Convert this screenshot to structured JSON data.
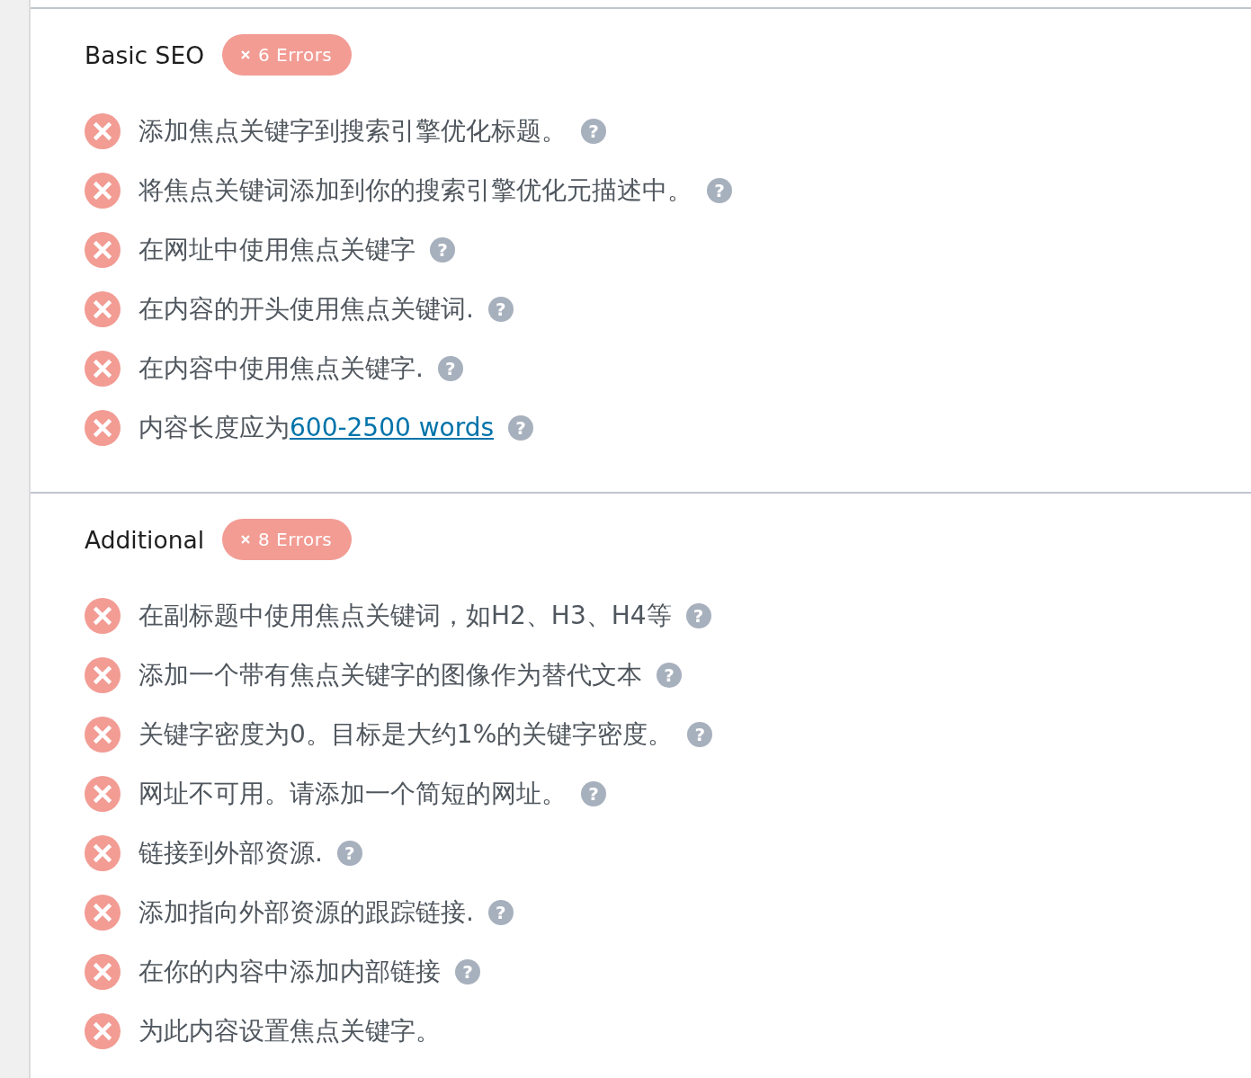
{
  "sections": [
    {
      "title": "Basic SEO",
      "badge": {
        "failed": true,
        "label": "6 Errors"
      },
      "checks": [
        {
          "failed": true,
          "text": "添加焦点关键字到搜索引擎优化标题。",
          "help": "?"
        },
        {
          "failed": true,
          "text": "将焦点关键词添加到你的搜索引擎优化元描述中。",
          "help": "?"
        },
        {
          "failed": true,
          "text": "在网址中使用焦点关键字",
          "help": "?"
        },
        {
          "failed": true,
          "text": "在内容的开头使用焦点关键词.",
          "help": "?"
        },
        {
          "failed": true,
          "text": "在内容中使用焦点关键字.",
          "help": "?"
        },
        {
          "failed": true,
          "text": "内容长度应为",
          "link": "600-2500 words",
          "help": "?"
        }
      ]
    },
    {
      "title": "Additional",
      "badge": {
        "failed": true,
        "label": "8 Errors"
      },
      "checks": [
        {
          "failed": true,
          "text": "在副标题中使用焦点关键词，如H2、H3、H4等",
          "help": "?"
        },
        {
          "failed": true,
          "text": "添加一个带有焦点关键字的图像作为替代文本",
          "help": "?"
        },
        {
          "failed": true,
          "text": "关键字密度为0。目标是大约1%的关键字密度。",
          "help": "?"
        },
        {
          "failed": true,
          "text": "网址不可用。请添加一个简短的网址。",
          "help": "?"
        },
        {
          "failed": true,
          "text": "链接到外部资源.",
          "help": "?"
        },
        {
          "failed": true,
          "text": "添加指向外部资源的跟踪链接.",
          "help": "?"
        },
        {
          "failed": true,
          "text": "在你的内容中添加内部链接",
          "help": "?"
        },
        {
          "failed": true,
          "text": "为此内容设置焦点关键字。"
        }
      ]
    }
  ]
}
